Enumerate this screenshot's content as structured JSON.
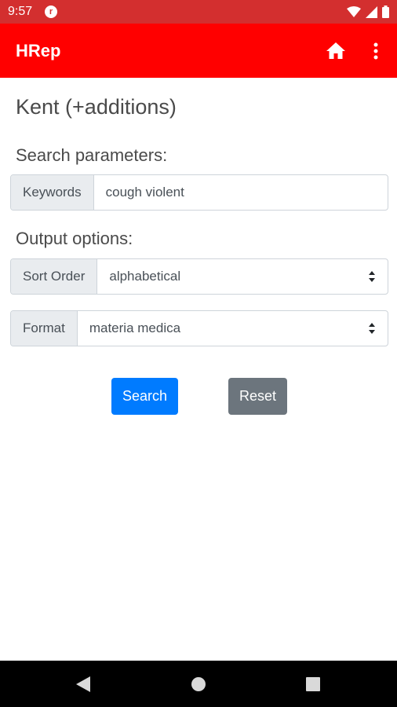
{
  "status_bar": {
    "time": "9:57",
    "app_icon_letter": "r"
  },
  "app_bar": {
    "title": "HRep"
  },
  "page": {
    "title": "Kent (+additions)"
  },
  "search": {
    "heading": "Search parameters:",
    "keywords_label": "Keywords",
    "keywords_value": "cough violent"
  },
  "output": {
    "heading": "Output options:",
    "sort_label": "Sort Order",
    "sort_value": "alphabetical",
    "format_label": "Format",
    "format_value": "materia medica"
  },
  "buttons": {
    "search": "Search",
    "reset": "Reset"
  },
  "colors": {
    "status_bar": "#d32f2f",
    "app_bar": "#ff0000",
    "search_button": "#007bff",
    "reset_button": "#6c757d"
  },
  "icons": [
    "wifi-icon",
    "signal-icon",
    "battery-icon",
    "home-icon",
    "more-vert-icon",
    "nav-back-icon",
    "nav-home-icon",
    "nav-recents-icon"
  ]
}
